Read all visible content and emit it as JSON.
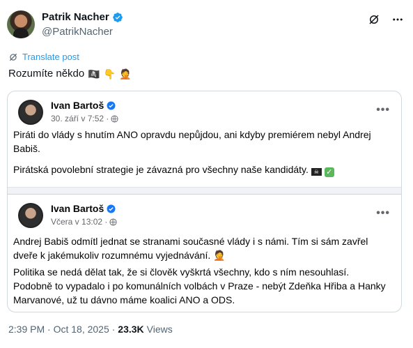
{
  "tweet": {
    "author_name": "Patrik Nacher",
    "author_handle": "@PatrikNacher",
    "translate_label": "Translate post",
    "text": "Rozumíte někdo",
    "emojis": [
      "🏴‍☠️",
      "👇",
      "🤦"
    ],
    "timestamp": "2:39 PM · Oct 18, 2025 ·",
    "views_count": "23.3K",
    "views_label": "Views"
  },
  "embedded": {
    "posts": [
      {
        "author": "Ivan Bartoš",
        "date": "30. září v 7:52 ·",
        "paragraph1": "Piráti do vlády s hnutím ANO opravdu nepůjdou, ani kdyby premiérem nebyl Andrej Babiš.",
        "paragraph2": "Pirátská povolební strategie je závazná pro všechny naše kandidáty."
      },
      {
        "author": "Ivan Bartoš",
        "date": "Včera v 13:02 ·",
        "paragraph1": "Andrej Babiš odmítl jednat se stranami současné vlády i s námi. Tím si sám zavřel dveře k jakémukoliv rozumnému vyjednávání.",
        "paragraph2": "Politika se nedá dělat tak, že si člověk vyškrtá všechny, kdo s ním nesouhlasí. Podobně to vypadalo i po komunálních volbách v Praze - nebýt Zdeňka Hřiba a Hanky Marvanové, už tu dávno máme koalici ANO a ODS."
      }
    ]
  },
  "colors": {
    "accent": "#1d9bf0",
    "verified_fb": "#1877f2",
    "muted": "#536471"
  }
}
